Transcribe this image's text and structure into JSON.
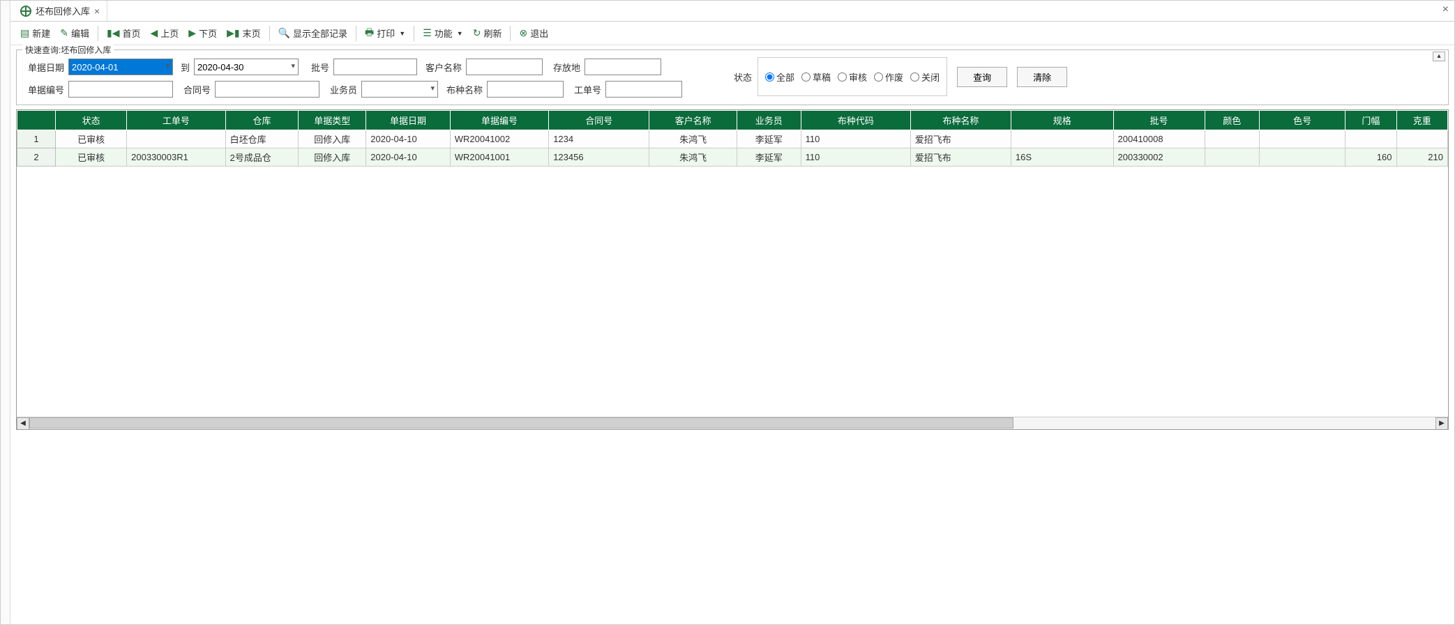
{
  "tab": {
    "title": "坯布回修入库"
  },
  "toolbar": {
    "new": "新建",
    "edit": "编辑",
    "first": "首页",
    "prev": "上页",
    "next": "下页",
    "last": "末页",
    "showAll": "显示全部记录",
    "print": "打印",
    "functions": "功能",
    "refresh": "刷新",
    "exit": "退出"
  },
  "query": {
    "legend": "快速查询:坯布回修入库",
    "labels": {
      "docDate": "单据日期",
      "to": "到",
      "batch": "批号",
      "custName": "客户名称",
      "location": "存放地",
      "docNo": "单据编号",
      "contractNo": "合同号",
      "salesperson": "业务员",
      "fabricName": "布种名称",
      "workOrder": "工单号",
      "status": "状态"
    },
    "values": {
      "dateFrom": "2020-04-01",
      "dateTo": "2020-04-30",
      "batch": "",
      "custName": "",
      "location": "",
      "docNo": "",
      "contractNo": "",
      "salesperson": "",
      "fabricName": "",
      "workOrder": ""
    },
    "statusOptions": {
      "all": "全部",
      "draft": "草稿",
      "approved": "审核",
      "void": "作废",
      "closed": "关闭"
    },
    "statusSelected": "all",
    "buttons": {
      "search": "查询",
      "clear": "清除"
    }
  },
  "grid": {
    "headers": {
      "status": "状态",
      "workOrder": "工单号",
      "warehouse": "仓库",
      "docType": "单据类型",
      "docDate": "单据日期",
      "docNo": "单据编号",
      "contractNo": "合同号",
      "custName": "客户名称",
      "salesperson": "业务员",
      "fabricCode": "布种代码",
      "fabricName": "布种名称",
      "spec": "规格",
      "batch": "批号",
      "color": "颜色",
      "colorNo": "色号",
      "width": "门幅",
      "weight": "克重"
    },
    "rows": [
      {
        "num": "1",
        "status": "已审核",
        "workOrder": "",
        "warehouse": "白坯仓库",
        "docType": "回修入库",
        "docDate": "2020-04-10",
        "docNo": "WR20041002",
        "contractNo": "1234",
        "custName": "朱鸿飞",
        "salesperson": "李延军",
        "fabricCode": "110",
        "fabricName": "爱招飞布",
        "spec": "",
        "batch": "200410008",
        "color": "",
        "colorNo": "",
        "width": "",
        "weight": ""
      },
      {
        "num": "2",
        "status": "已审核",
        "workOrder": "200330003R1",
        "warehouse": "2号成品仓",
        "docType": "回修入库",
        "docDate": "2020-04-10",
        "docNo": "WR20041001",
        "contractNo": "123456",
        "custName": "朱鸿飞",
        "salesperson": "李延军",
        "fabricCode": "110",
        "fabricName": "爱招飞布",
        "spec": "16S",
        "batch": "200330002",
        "color": "",
        "colorNo": "",
        "width": "160",
        "weight": "210"
      }
    ]
  }
}
